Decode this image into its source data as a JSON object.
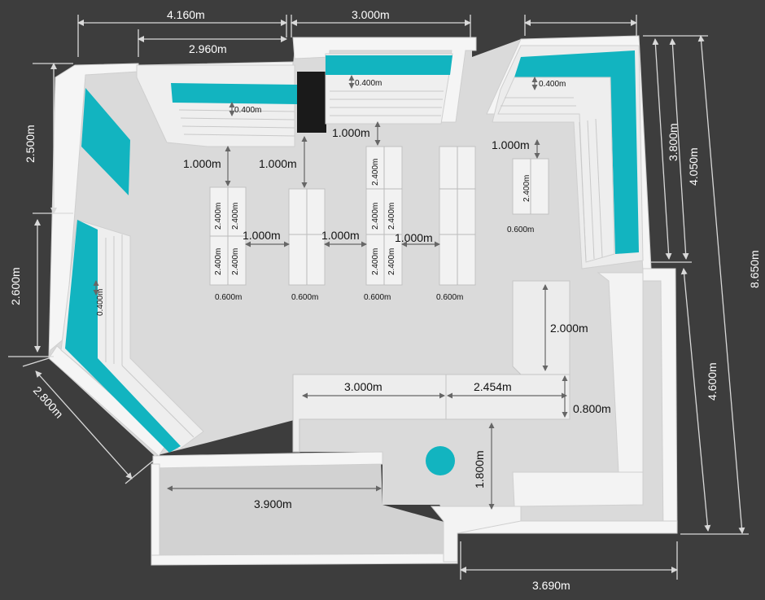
{
  "plan": {
    "accent_color": "#12b4c0",
    "floor_color": "#dcdcdc",
    "wall_color": "#f4f4f4",
    "background_color": "#3d3d3d"
  },
  "outer_dimensions": {
    "top_left": "4.160m",
    "top_left_inner": "2.960m",
    "top_center": "3.000m",
    "left_upper": "2.500m",
    "left_lower": "2.600m",
    "left_diagonal": "2.800m",
    "right_upper": "3.800m",
    "right_upper_total": "4.050m",
    "right_total": "8.650m",
    "right_lower": "4.600m",
    "bottom": "3.690m"
  },
  "interior_dimensions": {
    "shelf_depth_top_left": "0.400m",
    "shelf_depth_top_center": "0.400m",
    "shelf_depth_top_right": "0.400m",
    "shelf_depth_left": "0.400m",
    "aisle_top_1": "1.000m",
    "aisle_top_2": "1.000m",
    "aisle_top_3": "1.000m",
    "aisle_top_4": "1.000m",
    "aisle_between_1": "1.000m",
    "aisle_between_2": "1.000m",
    "aisle_between_3": "1.000m",
    "gondola_width_1": "0.600m",
    "gondola_width_2": "0.600m",
    "gondola_width_3": "0.600m",
    "gondola_width_4": "0.600m",
    "gondola_width_5": "0.600m",
    "gondola_len_1a": "2.400m",
    "gondola_len_1b": "2.400m",
    "gondola_len_1c": "2.400m",
    "gondola_len_1d": "2.400m",
    "gondola_len_3a": "2.400m",
    "gondola_len_3b": "2.400m",
    "gondola_len_3c": "2.400m",
    "gondola_len_3d": "2.400m",
    "gondola_len_3e": "2.400m",
    "gondola_len_5": "2.400m",
    "counter_left": "3.000m",
    "counter_right": "2.454m",
    "counter_return": "2.000m",
    "counter_depth": "0.800m",
    "entrance_depth": "1.800m",
    "storage_width": "3.900m"
  }
}
